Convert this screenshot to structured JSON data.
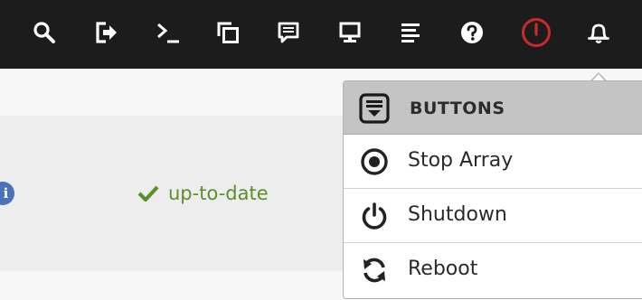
{
  "toolbar": {
    "icons": [
      {
        "name": "search-icon"
      },
      {
        "name": "logout-icon"
      },
      {
        "name": "terminal-icon"
      },
      {
        "name": "new-window-icon"
      },
      {
        "name": "feedback-icon"
      },
      {
        "name": "monitor-icon"
      },
      {
        "name": "log-icon"
      },
      {
        "name": "help-icon"
      },
      {
        "name": "power-icon",
        "color": "#cc2a2a"
      },
      {
        "name": "bell-icon"
      }
    ]
  },
  "page": {
    "info_badge": "i",
    "status_text": "up-to-date",
    "status_icon": "check-icon",
    "status_color": "#5a8f29"
  },
  "menu": {
    "header": {
      "label": "BUTTONS",
      "icon": "buttons-panel-icon"
    },
    "items": [
      {
        "label": "Stop Array",
        "icon": "stop-array-icon"
      },
      {
        "label": "Shutdown",
        "icon": "shutdown-icon"
      },
      {
        "label": "Reboot",
        "icon": "reboot-icon"
      }
    ]
  }
}
